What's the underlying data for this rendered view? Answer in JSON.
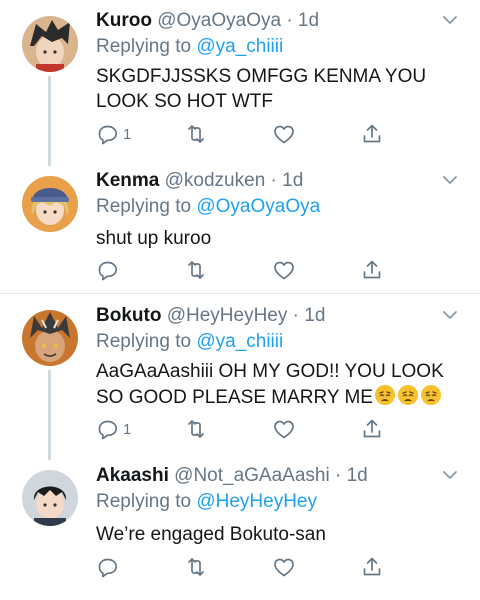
{
  "tweets": [
    {
      "name": "Kuroo",
      "handle": "@OyaOyaOya",
      "time": "· 1d",
      "reply_prefix": "Replying to ",
      "reply_to": "@ya_chiiii",
      "text": "SKGDFJJSSKS OMFGG KENMA YOU LOOK SO HOT WTF",
      "reply_count": "1",
      "avatar_colors": {
        "bg": "#d9b48f",
        "hair": "#2b2b2b",
        "skin": "#f2d5bd"
      }
    },
    {
      "name": "Kenma",
      "handle": "@kodzuken",
      "time": "· 1d",
      "reply_prefix": "Replying to ",
      "reply_to": "@OyaOyaOya",
      "text": "shut up kuroo",
      "reply_count": "",
      "avatar_colors": {
        "bg": "#e8a04a",
        "hair": "#e2c46a",
        "skin": "#f6dcc6",
        "hat": "#4a5a8a"
      }
    },
    {
      "name": "Bokuto",
      "handle": "@HeyHeyHey",
      "time": "· 1d",
      "reply_prefix": "Replying to ",
      "reply_to": "@ya_chiiii",
      "text": "AaGAaAashiii OH MY GOD!! YOU LOOK SO GOOD PLEASE MARRY ME",
      "emoji_icons": [
        "weary-face-icon",
        "weary-face-icon",
        "weary-face-icon"
      ],
      "reply_count": "1",
      "avatar_colors": {
        "bg": "#c9772f",
        "hair": "#3b3b3b",
        "skin": "#d7a47c"
      }
    },
    {
      "name": "Akaashi",
      "handle": "@Not_aGAaAashi",
      "time": "· 1d",
      "reply_prefix": "Replying to ",
      "reply_to": "@HeyHeyHey",
      "text": "We’re engaged Bokuto-san",
      "reply_count": "",
      "avatar_colors": {
        "bg": "#cfd6de",
        "hair": "#1c1c1c",
        "skin": "#f4dac6"
      }
    }
  ],
  "colors": {
    "link": "#1da1f2",
    "muted": "#657786",
    "thread": "#cfd9de",
    "divider": "#e1e8ed"
  },
  "icons": [
    "reply-icon",
    "retweet-icon",
    "like-icon",
    "share-icon",
    "chevron-down-icon"
  ]
}
